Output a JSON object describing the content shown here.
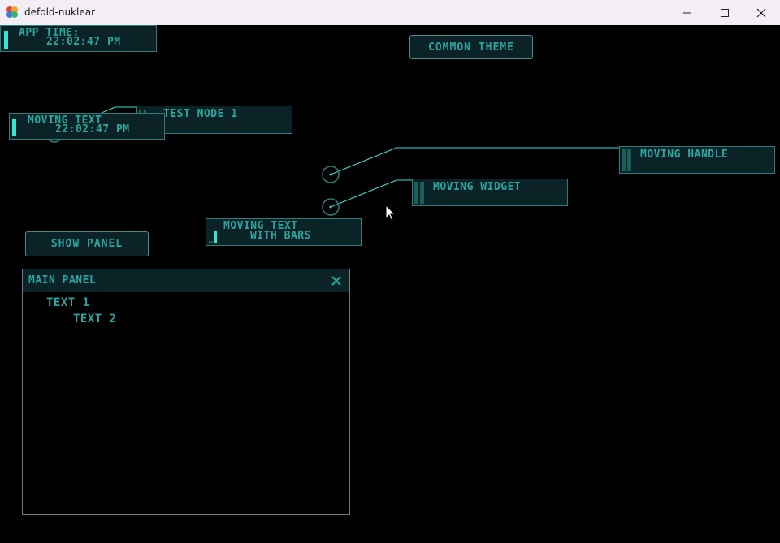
{
  "window": {
    "title": "defold-nuklear"
  },
  "app_time": {
    "label": "APP TIME:",
    "value": "22:02:47 PM"
  },
  "common_theme_button": "COMMON THEME",
  "test_node": {
    "label": "TEST NODE 1"
  },
  "moving_text": {
    "label": "MOVING TEXT",
    "value": "22:02:47 PM"
  },
  "moving_handle": {
    "label": "MOVING HANDLE"
  },
  "moving_widget": {
    "label": "MOVING WIDGET"
  },
  "moving_text_bars": {
    "line1": "MOVING TEXT",
    "line2": "WITH BARS"
  },
  "show_panel_button": "SHOW PANEL",
  "main_panel": {
    "title": "MAIN PANEL",
    "items": [
      "TEXT 1",
      "TEXT 2"
    ]
  },
  "colors": {
    "accent": "#35e6d6",
    "text": "#2aa6a0",
    "box_bg": "#0b2327",
    "border": "#2c7e7a",
    "background": "#000000"
  }
}
